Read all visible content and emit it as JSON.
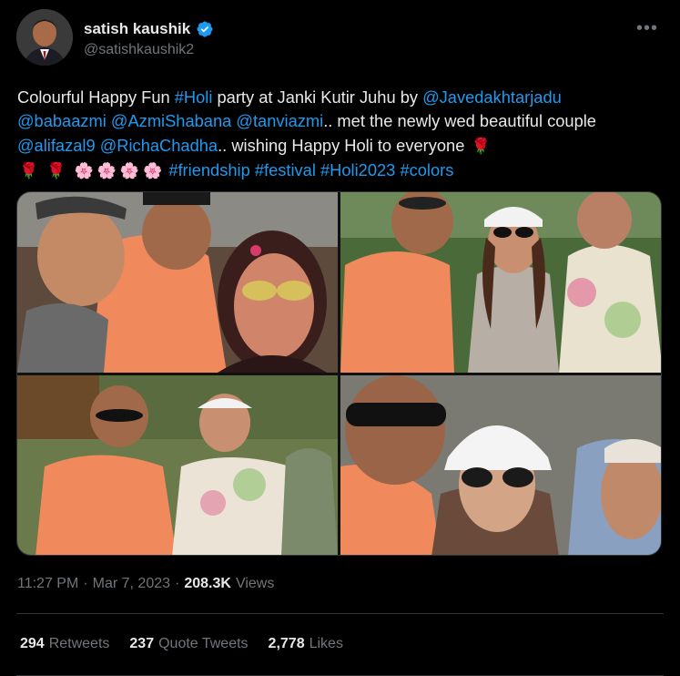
{
  "author": {
    "display_name": "satish kaushik",
    "handle": "@satishkaushik2",
    "verified": true
  },
  "menu_icon": "more-horizontal-icon",
  "tweet_text": {
    "t1": "Colourful Happy Fun ",
    "l1": "#Holi",
    "t2": " party at Janki Kutir Juhu by ",
    "l2": "@Javedakhtarjadu",
    "l3": "@babaazmi",
    "l4": "@AzmiShabana",
    "l5": "@tanviazmi",
    "t3": ".. met the newly wed beautiful couple ",
    "l6": "@alifazal9",
    "l7": "@RichaChadha",
    "t4": ".. wishing Happy Holi to everyone",
    "e_rose": "🌹",
    "e_flower": "🌸",
    "l8": "#friendship",
    "l9": "#festival",
    "l10": "#Holi2023",
    "l11": "#colors"
  },
  "meta": {
    "time": "11:27 PM",
    "sep": "·",
    "date": "Mar 7, 2023",
    "views_count": "208.3K",
    "views_label": "Views"
  },
  "stats": {
    "retweets_count": "294",
    "retweets_label": "Retweets",
    "quotes_count": "237",
    "quotes_label": "Quote Tweets",
    "likes_count": "2,778",
    "likes_label": "Likes"
  },
  "colors": {
    "link": "#1d9bf0",
    "text": "#e7e9ea",
    "muted": "#71767b",
    "background": "#000000"
  }
}
